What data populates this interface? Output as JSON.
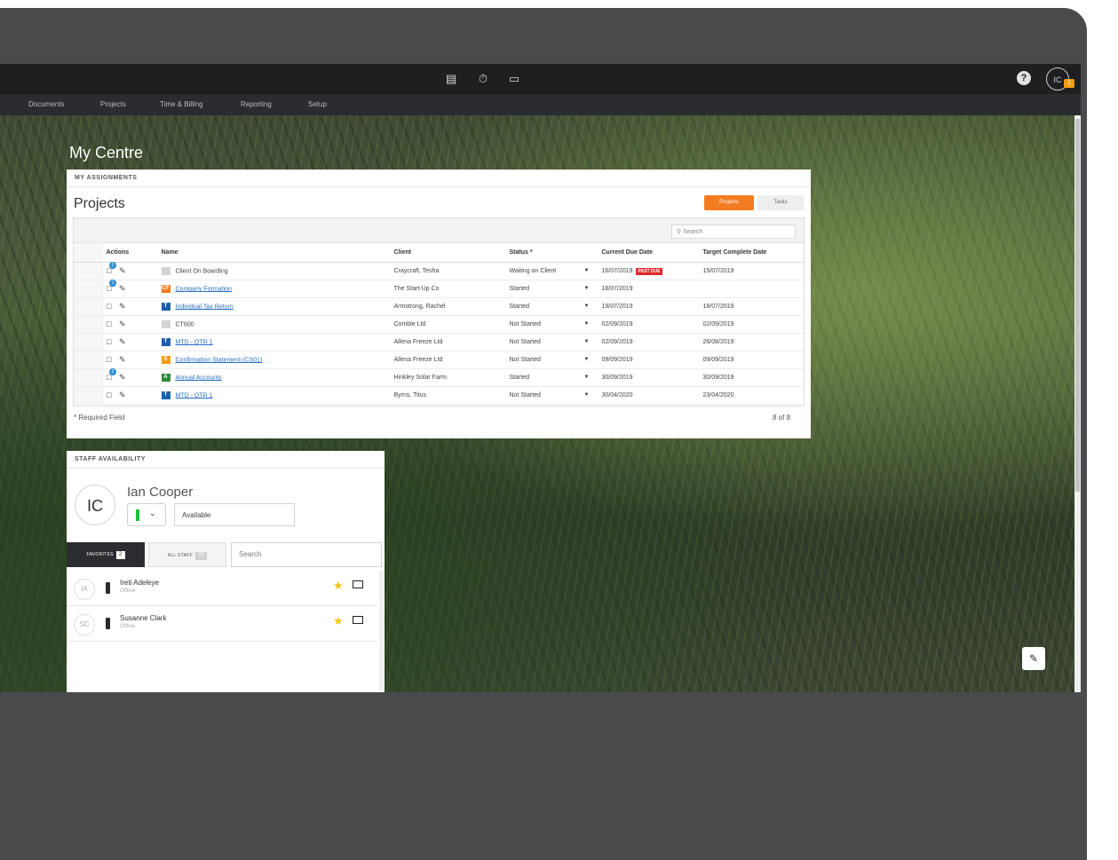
{
  "menu": [
    "Documents",
    "Projects",
    "Time & Billing",
    "Reporting",
    "Setup"
  ],
  "topbar": {
    "help": "?",
    "user_initials": "IC",
    "user_badge": "1"
  },
  "page_title": "My Centre",
  "assignments": {
    "section_label": "MY ASSIGNMENTS",
    "title": "Projects",
    "tab_projects": "Projects",
    "tab_tasks": "Tasks",
    "search_placeholder": "Search",
    "columns": [
      "Actions",
      "Name",
      "Client",
      "Status *",
      "Current Due Date",
      "Target Complete Date"
    ],
    "rows": [
      {
        "msg": "2",
        "type": "",
        "type_color": "#d4d4d4",
        "name": "Client On Boarding",
        "link": false,
        "client": "Craycraft, Tesha",
        "status": "Waiting on Client",
        "due": "16/07/2019",
        "past_due": "PAST DUE",
        "target": "15/07/2019"
      },
      {
        "msg": "1",
        "type": "CF",
        "type_color": "#f47c20",
        "name": "Company Formation",
        "link": true,
        "client": "The Start-Up Co",
        "status": "Started",
        "due": "18/07/2019",
        "past_due": "",
        "target": ""
      },
      {
        "msg": "",
        "type": "T",
        "type_color": "#1d5fa7",
        "name": "Individual Tax Return",
        "link": true,
        "client": "Armstrong, Rachel",
        "status": "Started",
        "due": "19/07/2019",
        "past_due": "",
        "target": "18/07/2019"
      },
      {
        "msg": "",
        "type": "",
        "type_color": "#d4d4d4",
        "name": "CT600",
        "link": false,
        "client": "Comble Ltd",
        "status": "Not Started",
        "due": "02/09/2019",
        "past_due": "",
        "target": "02/09/2019"
      },
      {
        "msg": "",
        "type": "T",
        "type_color": "#1d5fa7",
        "name": "MTD - QTR 1",
        "link": true,
        "client": "Allena Freeze Ltd",
        "status": "Not Started",
        "due": "02/09/2019",
        "past_due": "",
        "target": "26/08/2019"
      },
      {
        "msg": "",
        "type": "S",
        "type_color": "#f39c12",
        "name": "Confirmation Statement (CS01)",
        "link": true,
        "client": "Allena Freeze Ltd",
        "status": "Not Started",
        "due": "09/09/2019",
        "past_due": "",
        "target": "09/09/2019"
      },
      {
        "msg": "2",
        "type": "A",
        "type_color": "#2e8b3a",
        "name": "Annual Accounts",
        "link": true,
        "client": "Hinkley Solar Farm",
        "status": "Started",
        "due": "30/09/2019",
        "past_due": "",
        "target": "30/09/2019"
      },
      {
        "msg": "",
        "type": "T",
        "type_color": "#1d5fa7",
        "name": "MTD - QTR 1",
        "link": true,
        "client": "Byrns, Titus",
        "status": "Not Started",
        "due": "30/04/2020",
        "past_due": "",
        "target": "23/04/2020"
      }
    ],
    "required_note": "* Required Field",
    "count": "8 of 8"
  },
  "staff": {
    "section_label": "STAFF AVAILABILITY",
    "initials": "IC",
    "name": "Ian Cooper",
    "status_value": "Available",
    "status_color": "#1fbf3e",
    "tab_favorites": "FAVORITES",
    "favorites_count": "2",
    "tab_all": "ALL STAFF",
    "all_count": "20",
    "search_placeholder": "Search",
    "people": [
      {
        "initials": "IA",
        "name": "Ireti Adeleye",
        "status": "Offline"
      },
      {
        "initials": "SC",
        "name": "Susanne Clark",
        "status": "Offline"
      }
    ]
  },
  "colors": {
    "accent": "#f47c20",
    "past_due": "#e0282e",
    "topbar": "#1e1f21"
  }
}
